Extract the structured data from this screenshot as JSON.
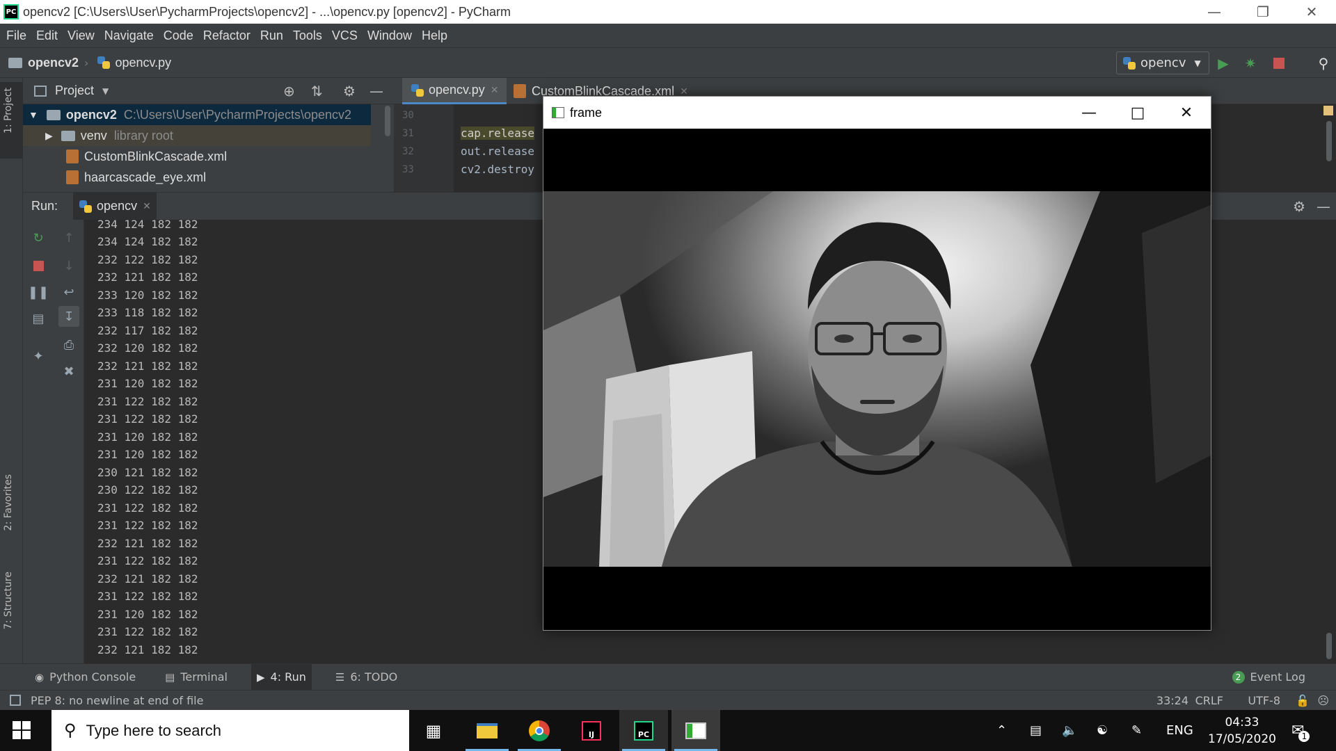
{
  "window": {
    "title": "opencv2 [C:\\Users\\User\\PycharmProjects\\opencv2] - ...\\opencv.py [opencv2] - PyCharm",
    "logo": "PC"
  },
  "menu": [
    "File",
    "Edit",
    "View",
    "Navigate",
    "Code",
    "Refactor",
    "Run",
    "Tools",
    "VCS",
    "Window",
    "Help"
  ],
  "navbar": {
    "project": "opencv2",
    "file": "opencv.py",
    "run_config": "opencv"
  },
  "left_strip": {
    "project_tab": "1: Project",
    "favorites_tab": "2: Favorites",
    "structure_tab": "7: Structure"
  },
  "project_panel": {
    "title": "Project",
    "tree": [
      {
        "name": "opencv2",
        "detail": "C:\\Users\\User\\PycharmProjects\\opencv2"
      },
      {
        "name": "venv",
        "detail": "library root"
      },
      {
        "name": "CustomBlinkCascade.xml",
        "detail": ""
      },
      {
        "name": "haarcascade_eye.xml",
        "detail": ""
      }
    ]
  },
  "editor": {
    "tabs": [
      {
        "label": "opencv.py"
      },
      {
        "label": "CustomBlinkCascade.xml"
      }
    ],
    "lines": [
      {
        "num": "30",
        "code": ""
      },
      {
        "num": "31",
        "code": "cap.release"
      },
      {
        "num": "32",
        "code": "out.release"
      },
      {
        "num": "33",
        "code": "cv2.destroy"
      }
    ]
  },
  "run_panel": {
    "label": "Run:",
    "tab": "opencv",
    "output": [
      "234 124 182 182",
      "234 124 182 182",
      "232 122 182 182",
      "232 121 182 182",
      "233 120 182 182",
      "233 118 182 182",
      "232 117 182 182",
      "232 120 182 182",
      "232 121 182 182",
      "231 120 182 182",
      "231 122 182 182",
      "231 122 182 182",
      "231 120 182 182",
      "231 120 182 182",
      "230 121 182 182",
      "230 122 182 182",
      "231 122 182 182",
      "231 122 182 182",
      "232 121 182 182",
      "231 122 182 182",
      "232 121 182 182",
      "231 122 182 182",
      "231 120 182 182",
      "231 122 182 182",
      "232 121 182 182"
    ]
  },
  "bottom_tabs": {
    "python_console": "Python Console",
    "terminal": "Terminal",
    "run": "4: Run",
    "todo": "6: TODO",
    "event_log": "Event Log",
    "event_count": "2"
  },
  "status": {
    "message": "PEP 8: no newline at end of file",
    "position": "33:24",
    "line_sep": "CRLF",
    "encoding": "UTF-8"
  },
  "frame_window": {
    "title": "frame"
  },
  "taskbar": {
    "search_placeholder": "Type here to search",
    "lang": "ENG",
    "time": "04:33",
    "date": "17/05/2020",
    "notif_count": "1"
  },
  "colors": {
    "ide_bg": "#2b2b2b",
    "panel_bg": "#3c3f41",
    "run_green": "#499c54",
    "stop_red": "#c75450"
  }
}
